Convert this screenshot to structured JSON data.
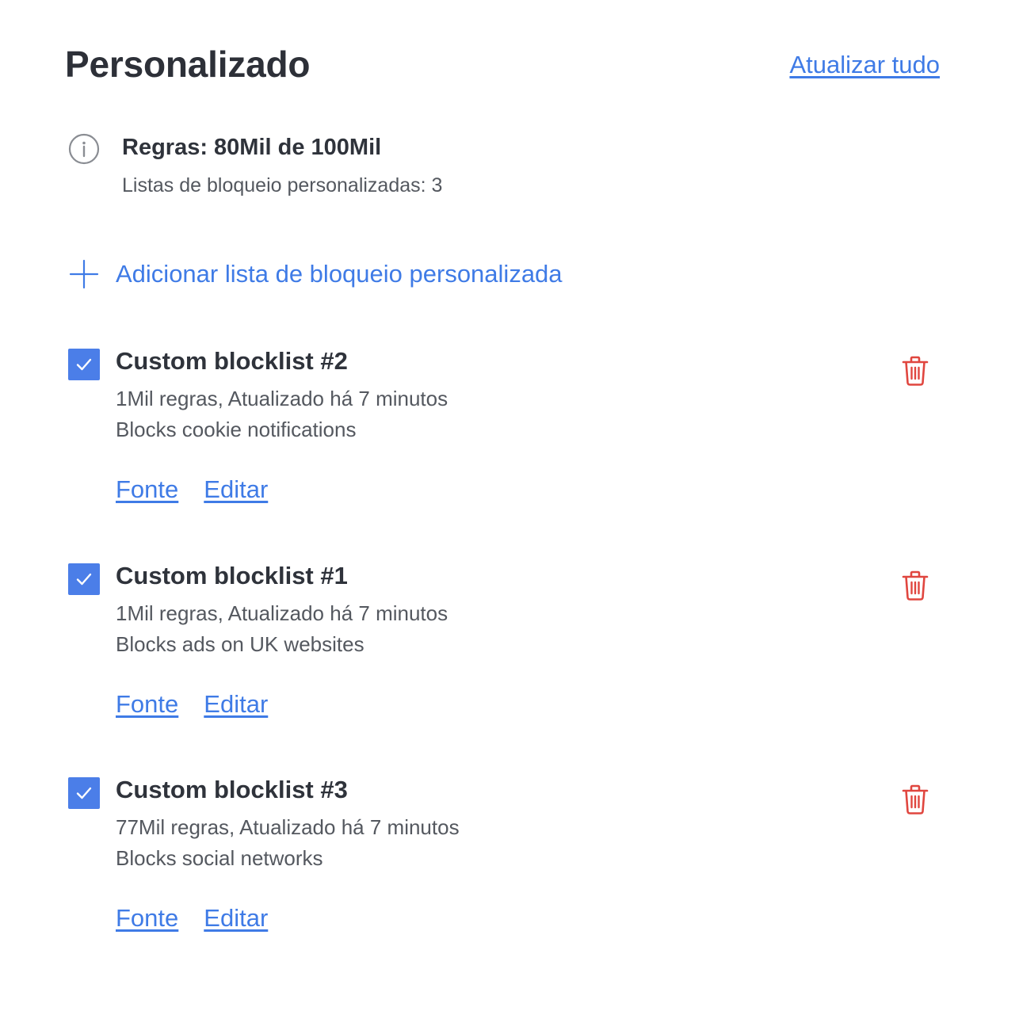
{
  "header": {
    "title": "Personalizado",
    "update_all_label": "Atualizar tudo"
  },
  "info": {
    "icon": "info-icon",
    "rules_text": "Regras: 80Mil de 100Mil",
    "lists_count_text": "Listas de bloqueio personalizadas: 3"
  },
  "add": {
    "icon": "plus-icon",
    "label": "Adicionar lista de bloqueio personalizada"
  },
  "colors": {
    "accent": "#3f7be6",
    "checkbox": "#4b7ee8",
    "delete": "#e0463f",
    "text": "#2f333b",
    "muted": "#54585f"
  },
  "blocklists": [
    {
      "title": "Custom blocklist #2",
      "checked": true,
      "meta": "1Mil regras, Atualizado há 7 minutos",
      "description": "Blocks cookie notifications",
      "source_label": "Fonte",
      "edit_label": "Editar"
    },
    {
      "title": "Custom blocklist #1",
      "checked": true,
      "meta": "1Mil regras, Atualizado há 7 minutos",
      "description": "Blocks ads on UK websites",
      "source_label": "Fonte",
      "edit_label": "Editar"
    },
    {
      "title": "Custom blocklist #3",
      "checked": true,
      "meta": "77Mil regras, Atualizado há 7 minutos",
      "description": "Blocks social networks",
      "source_label": "Fonte",
      "edit_label": "Editar"
    }
  ]
}
